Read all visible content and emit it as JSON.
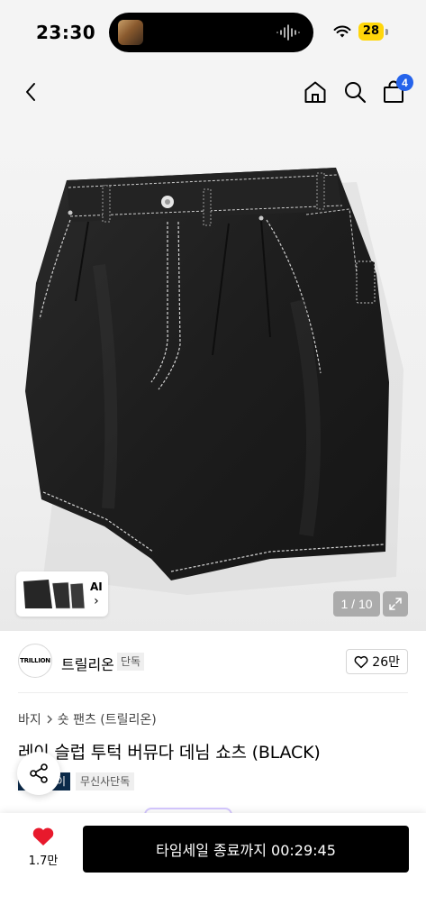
{
  "status": {
    "time": "23:30",
    "battery": "28"
  },
  "nav": {
    "cart_count": "4"
  },
  "gallery": {
    "ai_label": "AI",
    "ai_chevron": "›",
    "counter": "1 / 10"
  },
  "brand": {
    "name": "트릴리온",
    "tag": "단독",
    "logo_text": "TRILLION",
    "likes": "26만"
  },
  "product": {
    "breadcrumb": [
      "바지",
      "숏 팬츠 (트릴리온)"
    ],
    "title": "레이 슬럽 투턱 버뮤다 데님 쇼츠 (BLACK)",
    "tags": [
      "이",
      "무신사단독"
    ]
  },
  "bottom": {
    "heart_count": "1.7만",
    "cta_label": "타임세일 종료까지 00:29:45"
  },
  "colors": {
    "cta": "#000000",
    "heart": "#e8192c",
    "cart_badge": "#2563eb",
    "battery": "#ffd60a"
  }
}
